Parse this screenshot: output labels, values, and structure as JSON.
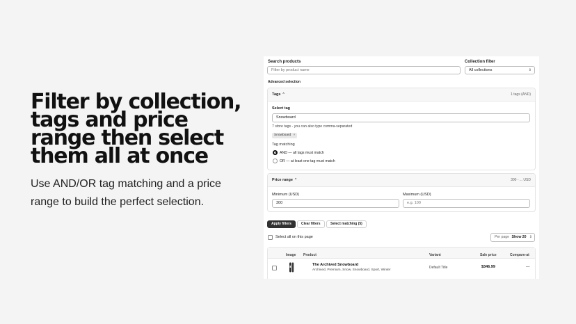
{
  "hero": {
    "title": "Filter by collection, tags and price range then select them all at once",
    "subtitle": "Use AND/OR tag matching and a price range to build the perfect selection."
  },
  "search": {
    "label": "Search products",
    "placeholder": "Filter by product name"
  },
  "collection": {
    "label": "Collection filter",
    "value": "All collections"
  },
  "advanced_label": "Advanced selection",
  "tags": {
    "header": "Tags",
    "summary": "1 tags (AND)",
    "select_label": "Select tag",
    "value": "Snowboard",
    "hint": "7 store tags - you can also type comma-separated",
    "chip": "Snowboard",
    "chip_remove": "×",
    "matching_label": "Tag matching",
    "options": [
      {
        "label": "AND — all tags must match",
        "selected": true
      },
      {
        "label": "OR — at least one tag must match",
        "selected": false
      }
    ]
  },
  "price": {
    "header": "Price range",
    "summary": "300 - ... USD",
    "min_label": "Minimum (USD)",
    "min_value": "300",
    "max_label": "Maximum (USD)",
    "max_placeholder": "e.g. 100"
  },
  "actions": {
    "apply": "Apply filters",
    "clear": "Clear filters",
    "select_matching": "Select matching (5)"
  },
  "select_all": "Select all on this page",
  "per_page": {
    "label": "Per page",
    "value": "Show 20"
  },
  "table": {
    "headers": [
      "Image",
      "Product",
      "Variant",
      "Sale price",
      "Compare-at"
    ],
    "rows": [
      {
        "title": "The Archived Snowboard",
        "tags": "Archived, Premium, Snow, Snowboard, Sport, Winter",
        "variant": "Default Title",
        "price": "$346.99",
        "compare": "—"
      }
    ]
  },
  "icons": {
    "chevron_up": "chevron-up-icon",
    "select_arrows": "select-arrows-icon",
    "close": "close-icon"
  }
}
